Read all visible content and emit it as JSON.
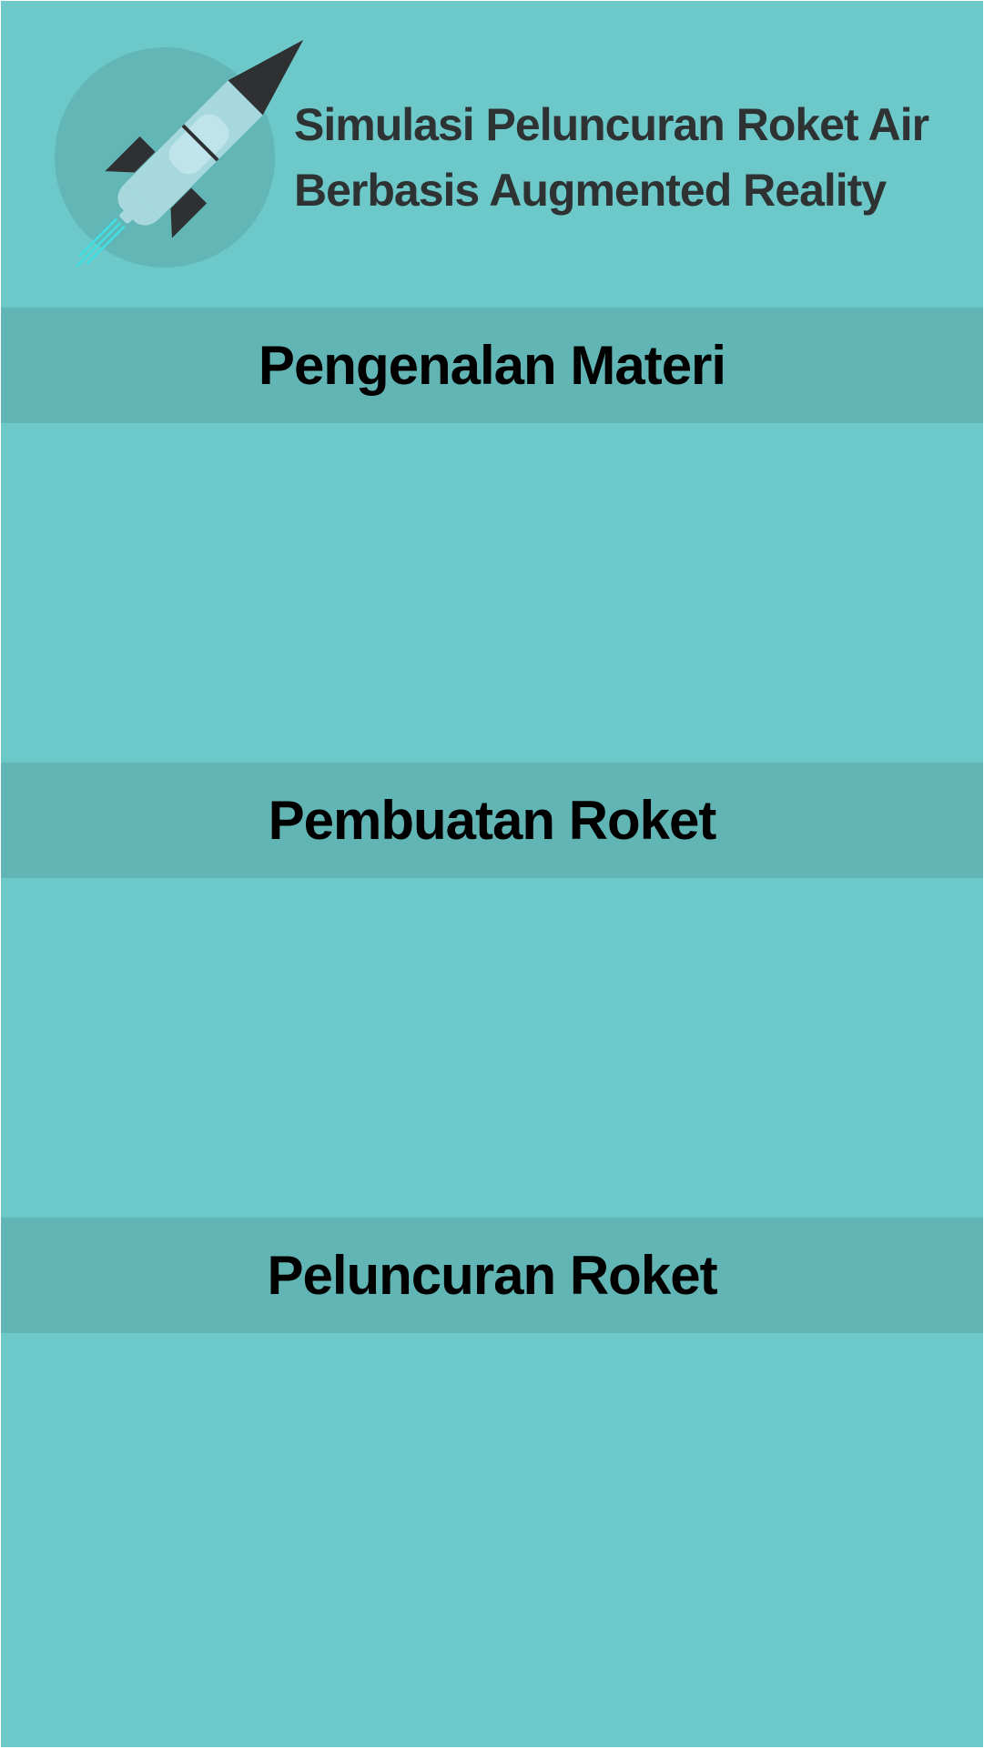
{
  "header": {
    "title_line_1": "Simulasi Peluncuran Roket Air",
    "title_line_2": "Berbasis Augmented Reality",
    "logo_icon": "water-rocket-icon"
  },
  "menu": {
    "items": [
      {
        "label": "Pengenalan Materi"
      },
      {
        "label": "Pembuatan Roket"
      },
      {
        "label": "Peluncuran Roket"
      }
    ]
  },
  "colors": {
    "background": "#6dc9c9",
    "menu_band": "#62b5b5",
    "logo_circle": "#63b6b6",
    "title_text": "#2f3232",
    "menu_text": "#000000",
    "rocket_body": "#a6d8de",
    "rocket_fins": "#2e3031",
    "exhaust": "#3ee0e3"
  }
}
